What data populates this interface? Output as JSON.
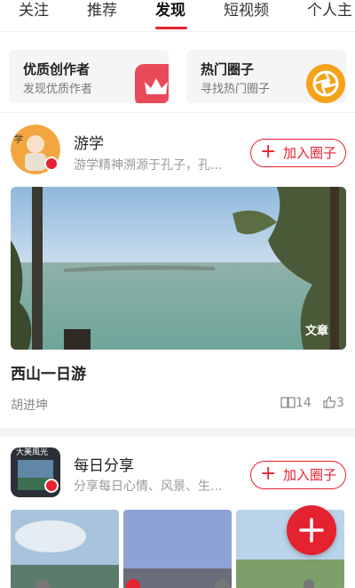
{
  "tabs": [
    {
      "label": "关注"
    },
    {
      "label": "推荐"
    },
    {
      "label": "发现"
    },
    {
      "label": "短视频"
    },
    {
      "label": "个人主"
    }
  ],
  "features": [
    {
      "title": "优质创作者",
      "subtitle": "发现优质作者",
      "icon": "crown-icon",
      "color": "#e94a5a"
    },
    {
      "title": "热门圈子",
      "subtitle": "寻找热门圈子",
      "icon": "aperture-icon",
      "color": "#f5a21b"
    }
  ],
  "circles": [
    {
      "name": "游学",
      "description": "游学精神溯源于孔子，孔...",
      "join_label": "加入圈子",
      "post": {
        "type_tag": "文章",
        "title": "西山一日游",
        "author": "胡进坤",
        "reads": "14",
        "likes": "3"
      }
    },
    {
      "name": "每日分享",
      "description": "分享每日心情、风景、生...",
      "avatar_text": "大美風光",
      "join_label": "加入圈子"
    }
  ],
  "colors": {
    "accent": "#e5222f"
  }
}
